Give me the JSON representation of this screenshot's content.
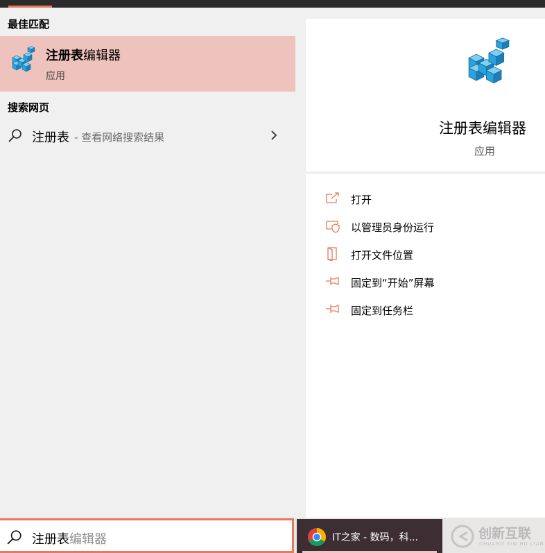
{
  "best_match": {
    "header": "最佳匹配",
    "title_bold": "注册表",
    "title_rest": "编辑器",
    "subtitle": "应用",
    "icon": "registry-editor-icon"
  },
  "web_search": {
    "header": "搜索网页",
    "query": "注册表",
    "hint": "- 查看网络搜索结果",
    "icon": "search-icon"
  },
  "preview": {
    "title": "注册表编辑器",
    "subtitle": "应用"
  },
  "actions": [
    {
      "label": "打开",
      "icon": "open-icon"
    },
    {
      "label": "以管理员身份运行",
      "icon": "run-as-admin-icon"
    },
    {
      "label": "打开文件位置",
      "icon": "file-location-icon"
    },
    {
      "label": "固定到“开始”屏幕",
      "icon": "pin-icon"
    },
    {
      "label": "固定到任务栏",
      "icon": "pin-icon"
    }
  ],
  "search_box": {
    "typed": "注册表",
    "suggestion": "编辑器"
  },
  "taskbar": {
    "chrome_label": "IT之家 - 数码，科..."
  },
  "watermark": {
    "main": "创新互联",
    "sub": "CHUANG XIN HU LIAN"
  },
  "colors": {
    "accent": "#e8795c",
    "highlight": "#efc3bd",
    "icon_blue": "#2aa3dd"
  }
}
